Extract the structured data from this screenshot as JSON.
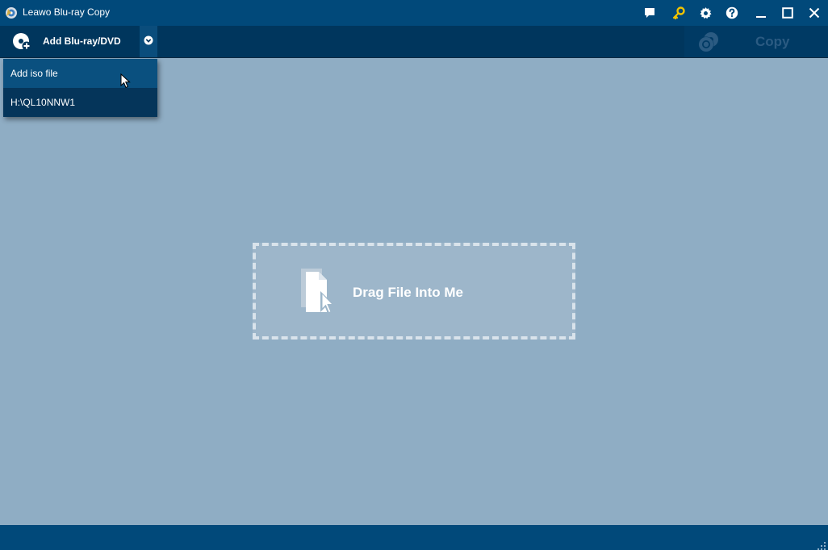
{
  "window": {
    "title": "Leawo Blu-ray Copy"
  },
  "titlebar_icons": [
    "chat-icon",
    "key-icon",
    "gear-icon",
    "help-icon",
    "minimize-icon",
    "maximize-icon",
    "close-icon"
  ],
  "toolbar": {
    "add_label": "Add Blu-ray/DVD",
    "copy_label": "Copy"
  },
  "dropdown": {
    "items": [
      {
        "label": "Add iso file"
      },
      {
        "label": "H:\\QL10NNW1"
      }
    ]
  },
  "dropzone": {
    "label": "Drag File Into Me"
  },
  "colors": {
    "titlebar": "#01497a",
    "toolbar": "#00365d",
    "content": "#8fadc4",
    "key_accent": "#f2c400",
    "copy_disabled": "#2b5b82"
  }
}
